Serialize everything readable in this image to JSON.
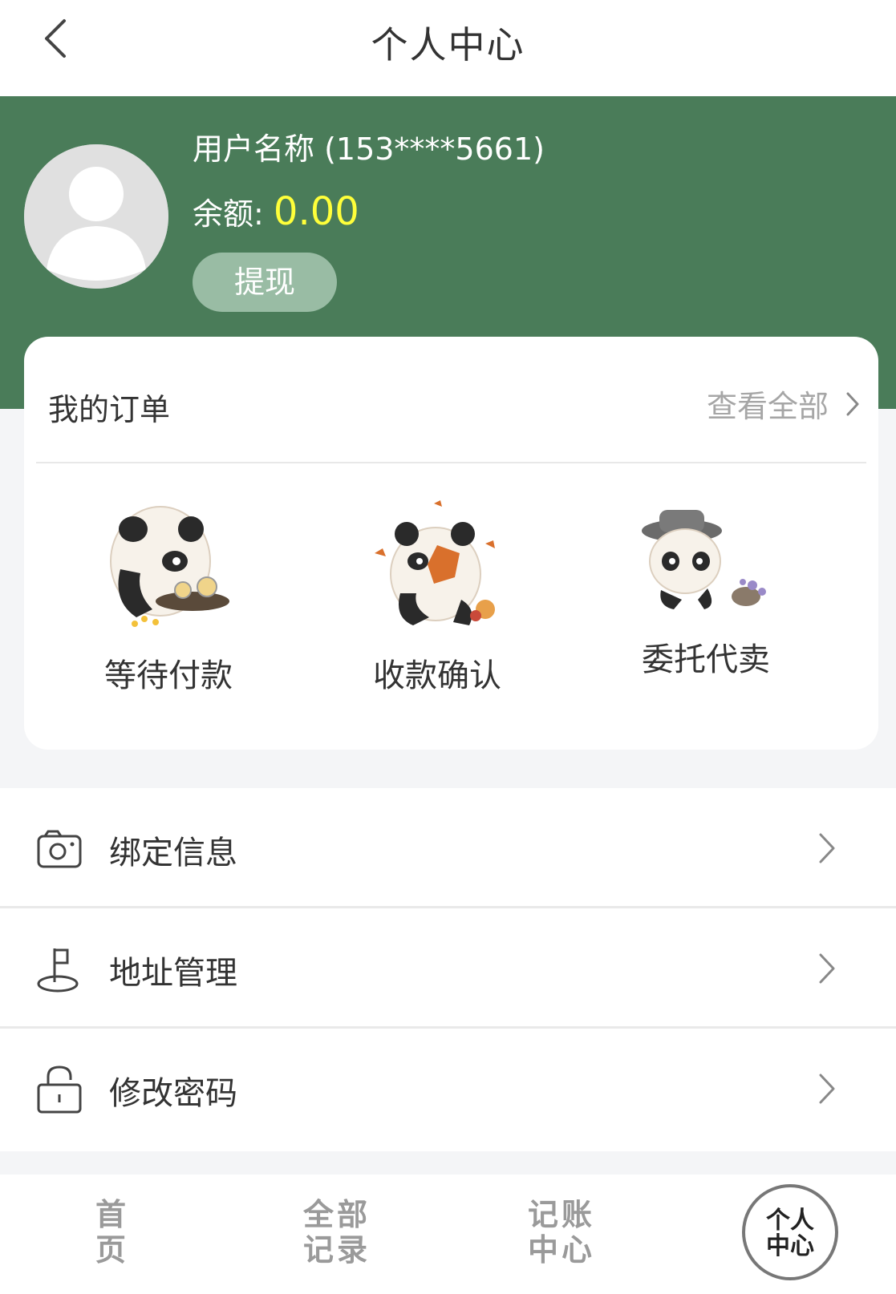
{
  "header": {
    "title": "个人中心"
  },
  "profile": {
    "username": "用户名称 (153****5661)",
    "balance_label": "余额:",
    "balance_value": "0.00",
    "withdraw_label": "提现"
  },
  "orders": {
    "title": "我的订单",
    "view_all_label": "查看全部",
    "items": [
      {
        "label": "等待付款",
        "icon": "panda-tea-icon"
      },
      {
        "label": "收款确认",
        "icon": "panda-leaf-icon"
      },
      {
        "label": "委托代卖",
        "icon": "panda-hat-icon"
      }
    ]
  },
  "menu": [
    {
      "label": "绑定信息",
      "icon": "camera-icon"
    },
    {
      "label": "地址管理",
      "icon": "flag-location-icon"
    },
    {
      "label": "修改密码",
      "icon": "lock-icon"
    }
  ],
  "tabbar": {
    "tabs": [
      {
        "line1": "首",
        "line2": "页"
      },
      {
        "line1": "全部",
        "line2": "记录"
      },
      {
        "line1": "记账",
        "line2": "中心"
      },
      {
        "line1": "个人",
        "line2": "中心"
      }
    ],
    "active_index": 3
  },
  "colors": {
    "banner": "#4a7c59",
    "balance": "#ffff3a",
    "withdraw_button": "#99bca4"
  }
}
